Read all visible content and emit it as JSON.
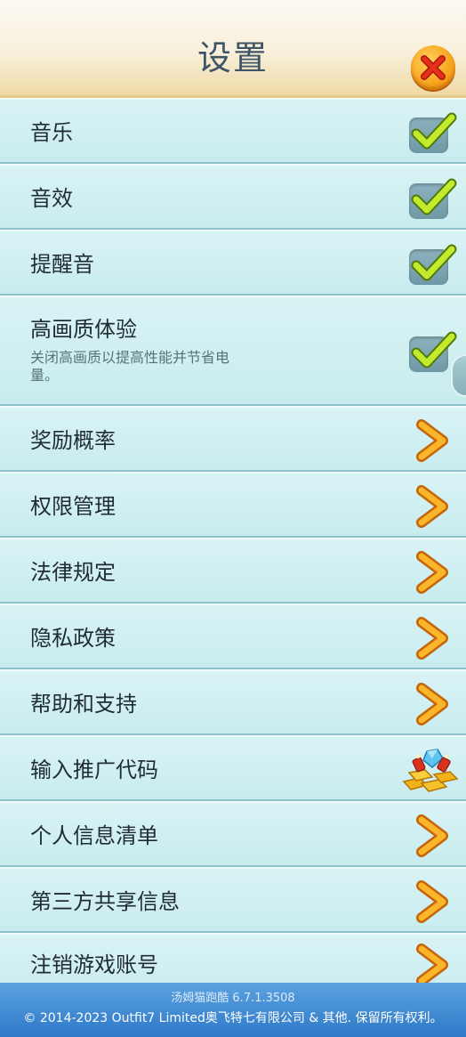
{
  "header": {
    "title": "设置",
    "close_icon": "close-icon"
  },
  "rows": [
    {
      "label": "音乐",
      "control": "checkbox",
      "checked": true
    },
    {
      "label": "音效",
      "control": "checkbox",
      "checked": true
    },
    {
      "label": "提醒音",
      "control": "checkbox",
      "checked": true
    },
    {
      "label": "高画质体验",
      "sub": "关闭高画质以提高性能并节省电量。",
      "control": "checkbox",
      "checked": true
    },
    {
      "label": "奖励概率",
      "control": "arrow"
    },
    {
      "label": "权限管理",
      "control": "arrow"
    },
    {
      "label": "法律规定",
      "control": "arrow"
    },
    {
      "label": "隐私政策",
      "control": "arrow"
    },
    {
      "label": "帮助和支持",
      "control": "arrow"
    },
    {
      "label": "输入推广代码",
      "control": "gift"
    },
    {
      "label": "个人信息清单",
      "control": "arrow"
    },
    {
      "label": "第三方共享信息",
      "control": "arrow"
    },
    {
      "label": "注销游戏账号",
      "control": "arrow"
    }
  ],
  "footer": {
    "version": "汤姆猫跑酷 6.7.1.3508",
    "copyright": "© 2014-2023 Outfit7 Limited奥飞特七有限公司 & 其他. 保留所有权利。"
  },
  "colors": {
    "row_bg": "#d0eff1",
    "check_green": "#b4e02a",
    "arrow_orange": "#f6a21b",
    "footer_blue": "#3f8bd6"
  }
}
